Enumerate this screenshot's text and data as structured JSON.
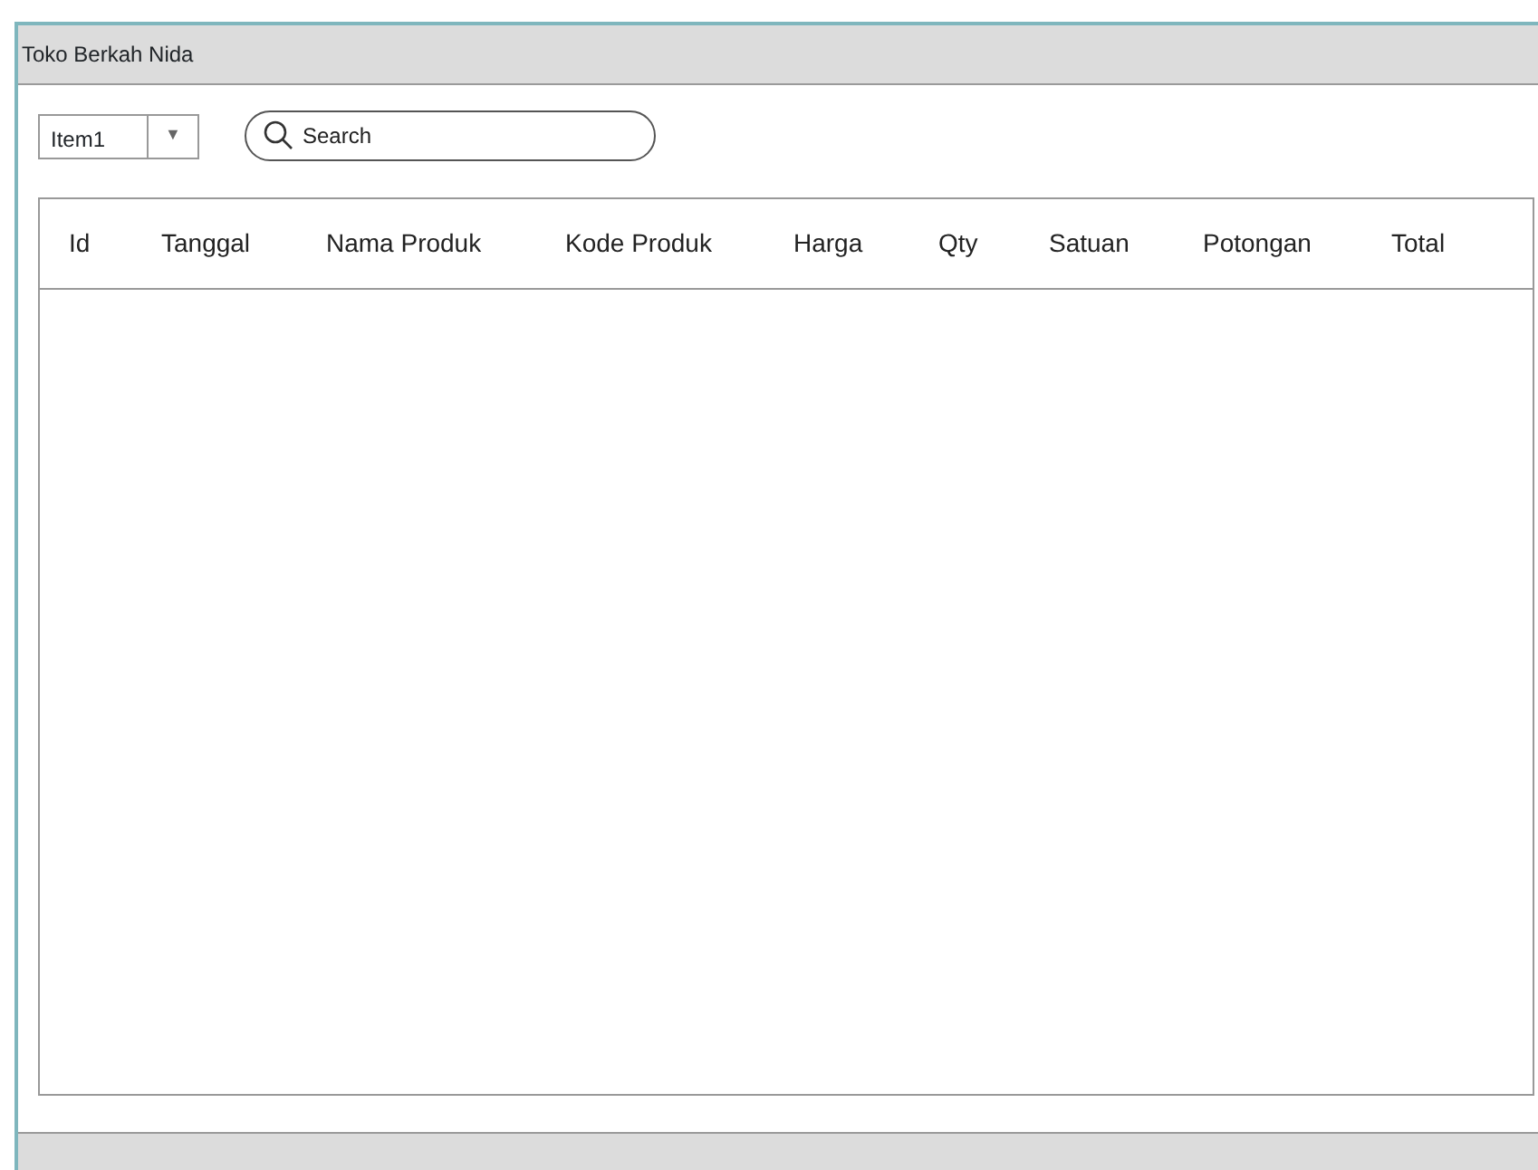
{
  "window": {
    "title": "Toko Berkah Nida"
  },
  "toolbar": {
    "dropdown": {
      "value": "Item1",
      "caret": "▼"
    },
    "search": {
      "placeholder": "Search"
    }
  },
  "table": {
    "columns": [
      "Id",
      "Tanggal",
      "Nama Produk",
      "Kode Produk",
      "Harga",
      "Qty",
      "Satuan",
      "Potongan",
      "Total"
    ]
  }
}
